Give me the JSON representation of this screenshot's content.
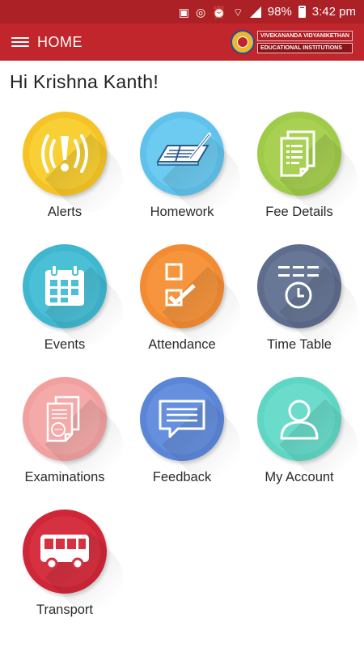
{
  "status_bar": {
    "battery": "98%",
    "time": "3:42 pm"
  },
  "app_bar": {
    "title": "HOME",
    "logo_line1": "VIVEKANANDA VIDYANIKETHAN",
    "logo_line2": "EDUCATIONAL INSTITUTIONS"
  },
  "greeting": "Hi  Krishna Kanth!",
  "tiles": [
    {
      "label": "Alerts",
      "icon": "alert-icon",
      "outer": "#f6c326",
      "inner": "#f8cf34"
    },
    {
      "label": "Homework",
      "icon": "homework-icon",
      "outer": "#5fc2ec",
      "inner": "#6dcaf0"
    },
    {
      "label": "Fee Details",
      "icon": "fee-document-icon",
      "outer": "#9fcb48",
      "inner": "#a8d052"
    },
    {
      "label": "Events",
      "icon": "calendar-icon",
      "outer": "#3fb7cf",
      "inner": "#4bbfd6"
    },
    {
      "label": "Attendance",
      "icon": "checkbox-icon",
      "outer": "#f38b33",
      "inner": "#f6953e"
    },
    {
      "label": "Time Table",
      "icon": "clock-icon",
      "outer": "#5e6c8e",
      "inner": "#687796"
    },
    {
      "label": "Examinations",
      "icon": "exam-paper-icon",
      "outer": "#f1a0a0",
      "inner": "#f4aaa9"
    },
    {
      "label": "Feedback",
      "icon": "chat-bubble-icon",
      "outer": "#5b86d8",
      "inner": "#6690dd"
    },
    {
      "label": "My Account",
      "icon": "user-icon",
      "outer": "#5fd6c3",
      "inner": "#6bdccb"
    },
    {
      "label": "Transport",
      "icon": "bus-icon",
      "outer": "#cf2638",
      "inner": "#d63141"
    }
  ]
}
